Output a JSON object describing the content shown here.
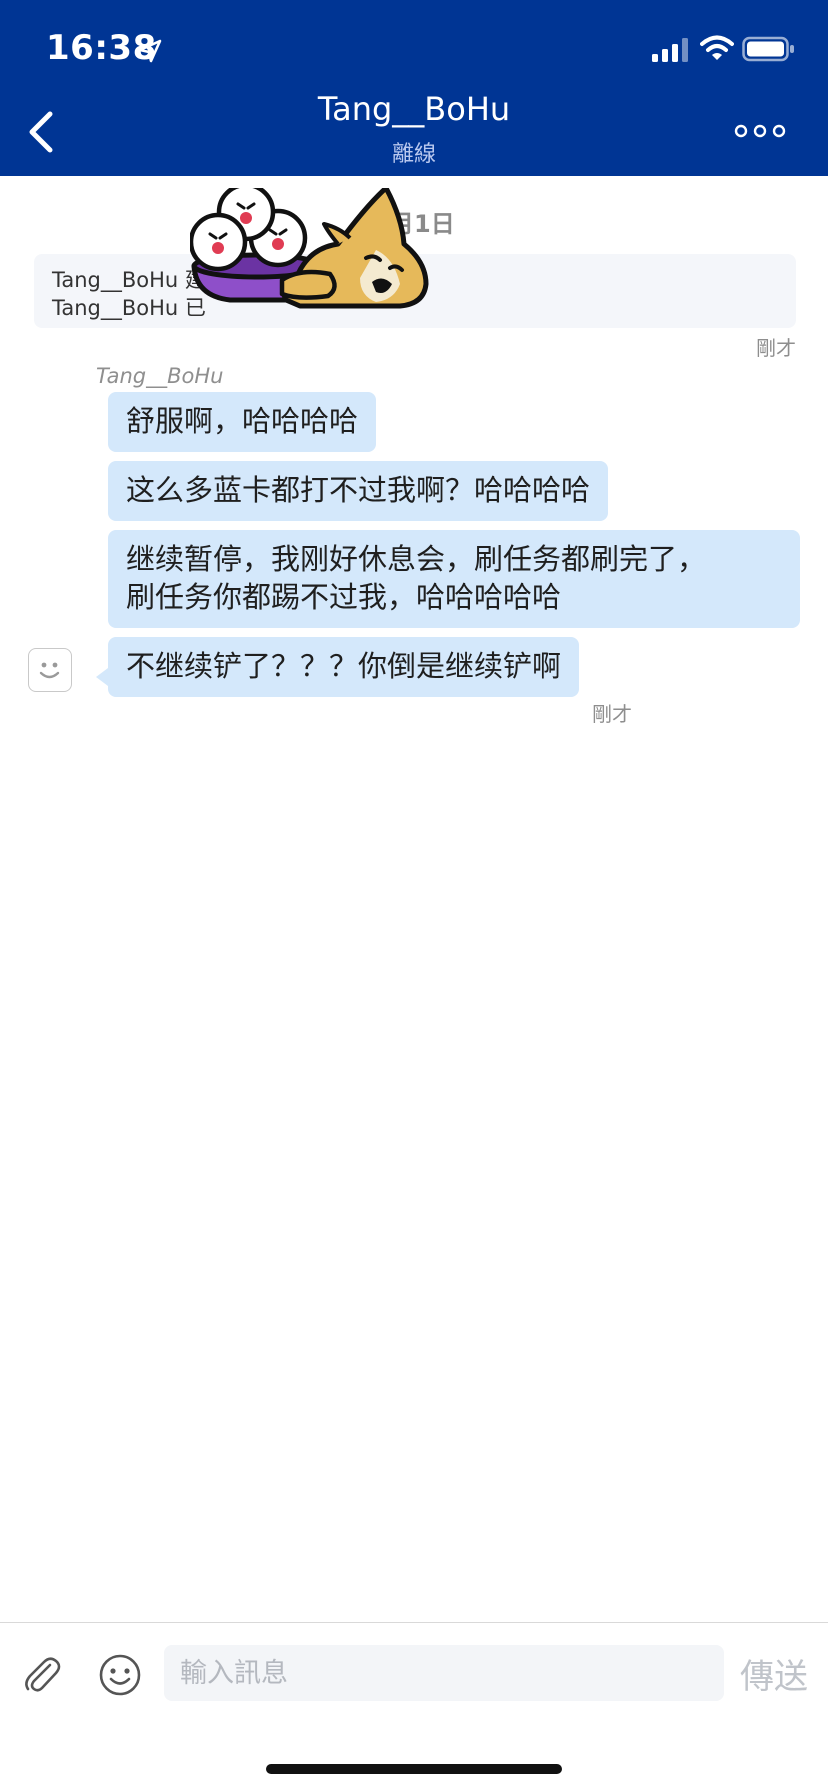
{
  "status_bar": {
    "time": "16:38"
  },
  "header": {
    "title": "Tang__BoHu",
    "subtitle": "離線"
  },
  "conversation": {
    "date_separator": "2月1日",
    "system_messages": [
      "Tang__BoHu 建",
      "Tang__BoHu 已"
    ],
    "system_time": "剛才",
    "sender_name": "Tang__BoHu",
    "messages": [
      {
        "text": "舒服啊，哈哈哈哈"
      },
      {
        "text": "这么多蓝卡都打不过我啊？哈哈哈哈"
      },
      {
        "line1": "继续暂停，我刚好休息会，刷任务都刷完了，",
        "line2": "刷任务你都踢不过我，哈哈哈哈哈"
      },
      {
        "text": "不继续铲了？？？你倒是继续铲啊"
      }
    ],
    "last_time": "剛才"
  },
  "composer": {
    "placeholder": "輸入訊息",
    "send_label": "傳送"
  },
  "icons": {
    "back": "chevron-left-icon",
    "more": "more-horizontal-icon",
    "attach": "paperclip-icon",
    "emoji": "smiley-icon",
    "avatar": "default-avatar-icon",
    "location": "location-arrow-icon",
    "signal": "cellular-signal-icon",
    "wifi": "wifi-icon",
    "battery": "battery-icon"
  },
  "colors": {
    "header_bg": "#003594",
    "bubble_bg": "#d4e8fb",
    "input_bg": "#f3f5f8"
  }
}
